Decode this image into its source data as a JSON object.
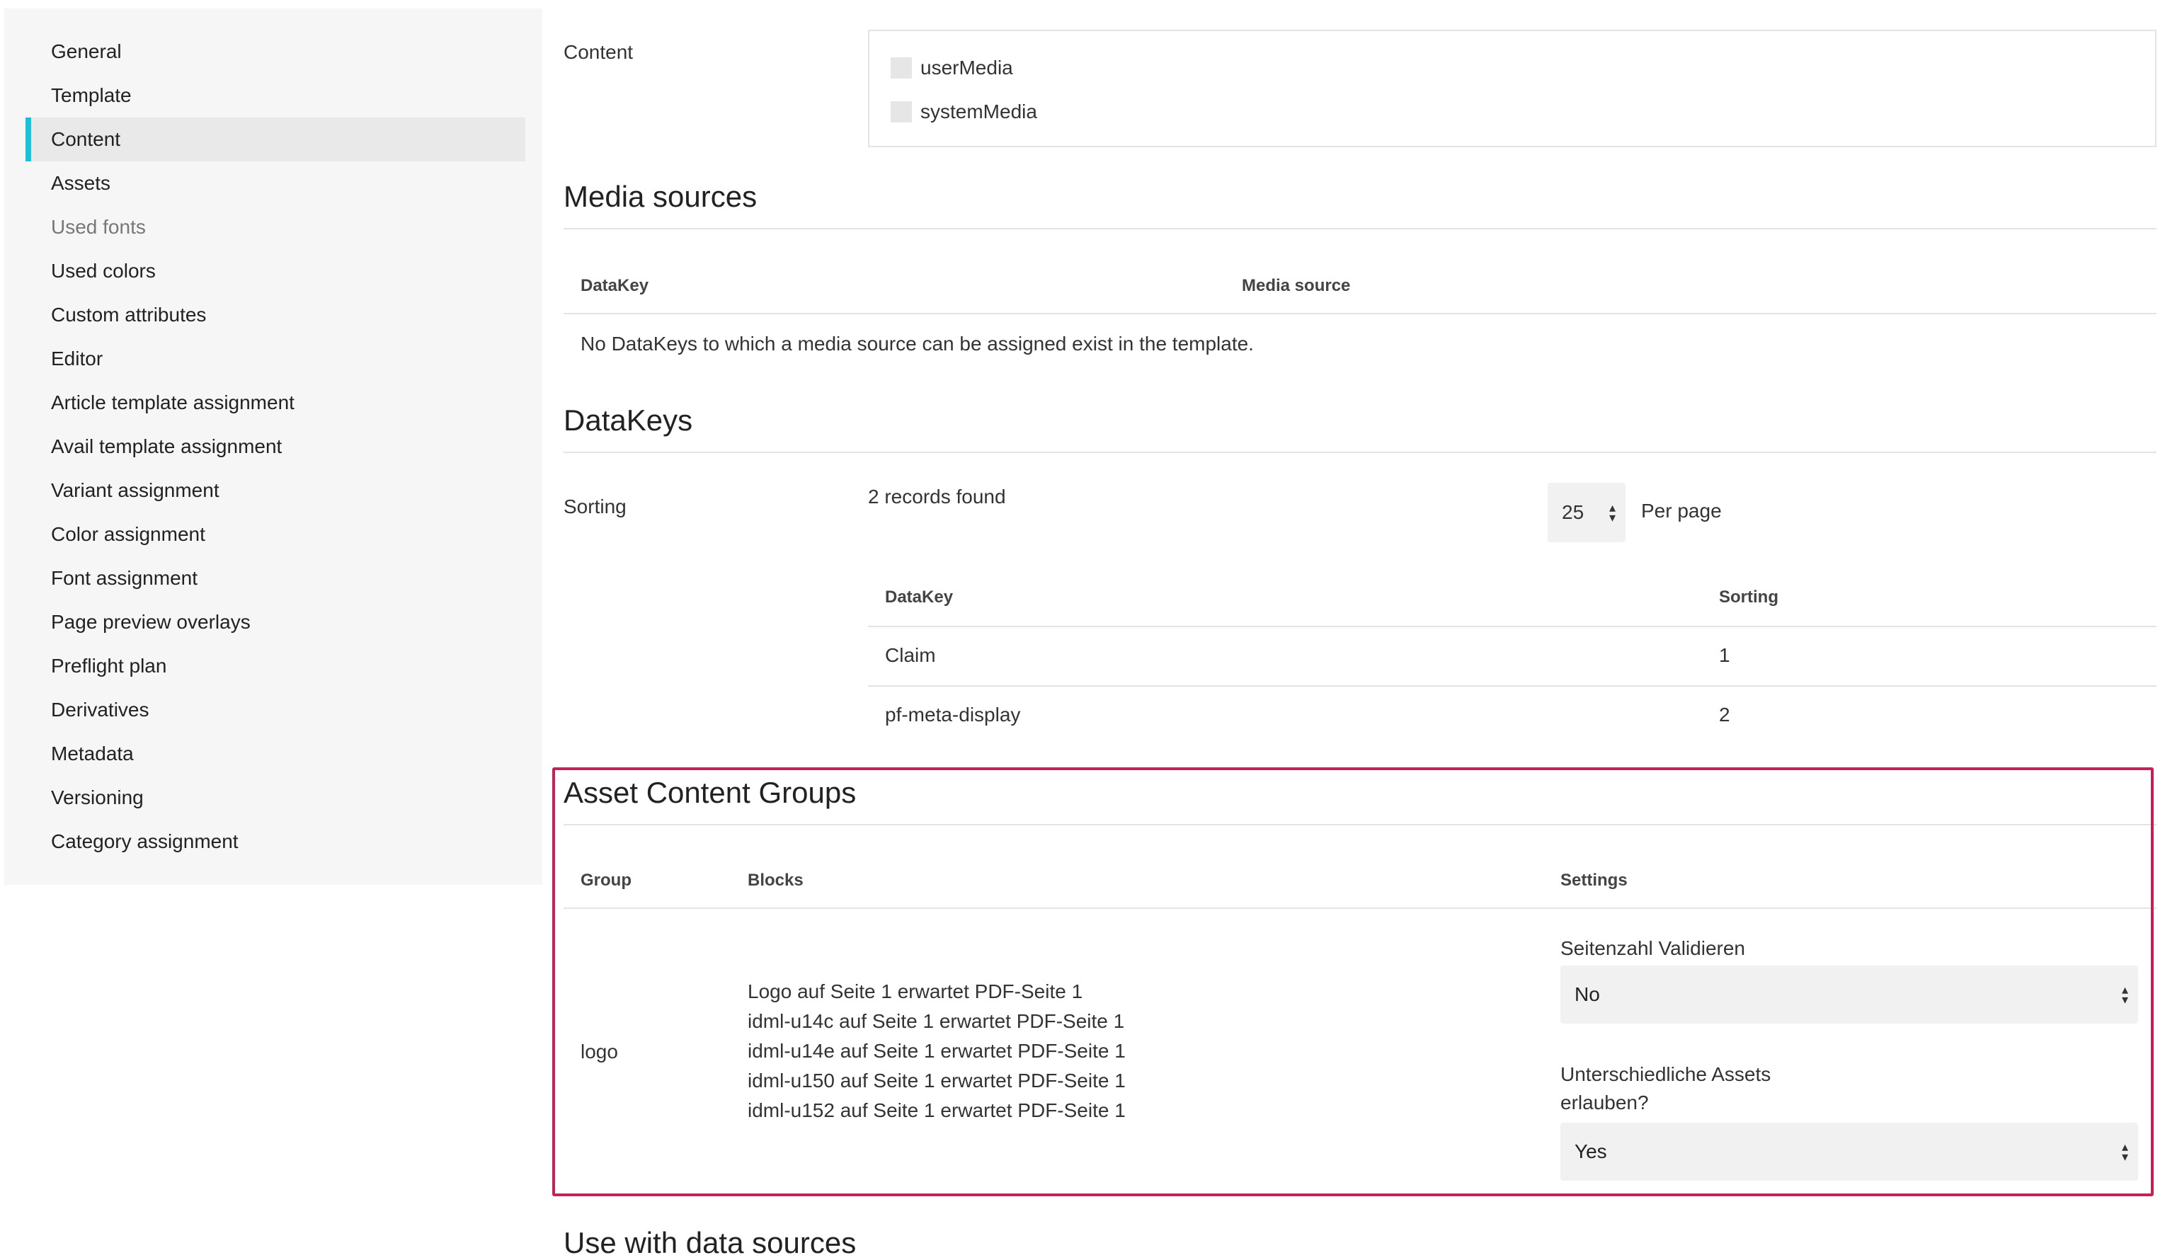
{
  "sidebar": {
    "items": [
      {
        "label": "General"
      },
      {
        "label": "Template"
      },
      {
        "label": "Content"
      },
      {
        "label": "Assets"
      },
      {
        "label": "Used fonts"
      },
      {
        "label": "Used colors"
      },
      {
        "label": "Custom attributes"
      },
      {
        "label": "Editor"
      },
      {
        "label": "Article template assignment"
      },
      {
        "label": "Avail template assignment"
      },
      {
        "label": "Variant assignment"
      },
      {
        "label": "Color assignment"
      },
      {
        "label": "Font assignment"
      },
      {
        "label": "Page preview overlays"
      },
      {
        "label": "Preflight plan"
      },
      {
        "label": "Derivatives"
      },
      {
        "label": "Metadata"
      },
      {
        "label": "Versioning"
      },
      {
        "label": "Category assignment"
      }
    ],
    "active": "Content"
  },
  "content": {
    "label": "Content",
    "options": [
      {
        "label": "userMedia",
        "checked": false
      },
      {
        "label": "systemMedia",
        "checked": false
      }
    ]
  },
  "media_sources": {
    "title": "Media sources",
    "columns": [
      "DataKey",
      "Media source"
    ],
    "empty_text": "No DataKeys to which a media source can be assigned exist in the template."
  },
  "datakeys": {
    "title": "DataKeys",
    "sorting_label": "Sorting",
    "records_found": "2 records found",
    "per_page_value": "25",
    "per_page_label": "Per page",
    "columns": [
      "DataKey",
      "Sorting"
    ],
    "rows": [
      {
        "datakey": "Claim",
        "sorting": "1"
      },
      {
        "datakey": "pf-meta-display",
        "sorting": "2"
      }
    ]
  },
  "asset_content_groups": {
    "title": "Asset Content Groups",
    "columns": [
      "Group",
      "Blocks",
      "Settings"
    ],
    "row": {
      "group": "logo",
      "blocks": [
        "Logo auf Seite 1 erwartet PDF-Seite 1",
        "idml-u14c auf Seite 1 erwartet PDF-Seite 1",
        "idml-u14e auf Seite 1 erwartet PDF-Seite 1",
        "idml-u150 auf Seite 1 erwartet PDF-Seite 1",
        "idml-u152 auf Seite 1 erwartet PDF-Seite 1"
      ],
      "setting1_label": "Seitenzahl Validieren",
      "setting1_value": "No",
      "setting2_label_line1": "Unterschiedliche Assets",
      "setting2_label_line2": "erlauben?",
      "setting2_value": "Yes"
    },
    "highlight_color": "#c4215a"
  },
  "next_section": {
    "title": "Use with data sources"
  },
  "colors": {
    "accent": "#19c1d6",
    "highlight": "#c4215a"
  }
}
